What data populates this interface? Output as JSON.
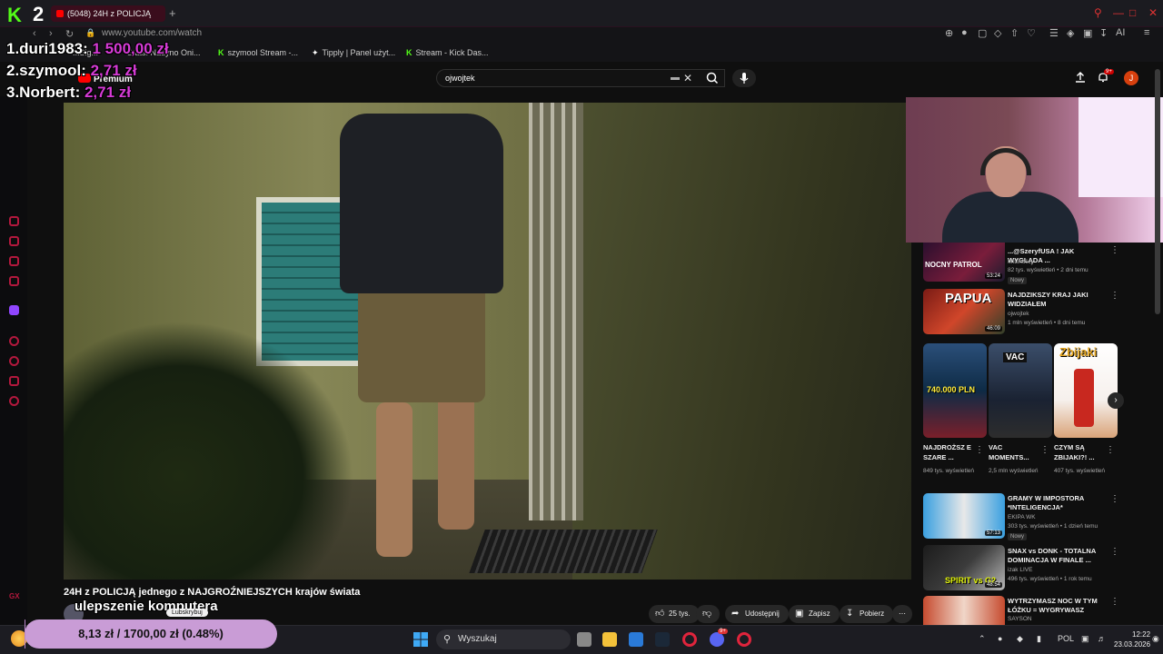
{
  "browser": {
    "tab_title": "(5048) 24H z POLICJĄ",
    "url": "www.youtube.com/watch",
    "bookmarks": [
      "...Sig...",
      "Stats: Nadyno Oni...",
      "szymool Stream -...",
      "Tipply | Panel użyt...",
      "Stream - Kick Das..."
    ],
    "ai_label": "AI",
    "app_number": "2"
  },
  "donors": [
    {
      "rank_name": "1.duri1983:",
      "amount": "1 500,00 zł"
    },
    {
      "rank_name": "2.szymool:",
      "amount": "2,71 zł"
    },
    {
      "rank_name": "3.Norbert:",
      "amount": "2,71 zł"
    }
  ],
  "youtube": {
    "premium_label": "Premium",
    "search_query": "ojwojtek",
    "notifications_badge": "9+",
    "user_initial": "J"
  },
  "video": {
    "title": "24H z POLICJĄ jednego z NAJGROŹNIEJSZYCH krajów świata",
    "overlay_text": "ulepszenie komputera",
    "subscribe_label": "Lubskrybuj",
    "like_count": "25 tys.",
    "share_label": "Udostępnij",
    "save_label": "Zapisz",
    "download_label": "Pobierz"
  },
  "recommendations": [
    {
      "title": "...@SzeryfUSA ! JAK WYGLĄDA ...",
      "channel": "MILiholicy",
      "meta": "82 tys. wyświetleń • 2 dni temu",
      "duration": "53:24",
      "badge": "Nowy",
      "thumb_text": "NOCNY PATROL"
    },
    {
      "title": "NAJDZIKSZY KRAJ JAKI WIDZIAŁEM",
      "channel": "ojwojtek",
      "meta": "1 mln wyświetleń • 8 dni temu",
      "duration": "46:09",
      "badge": "",
      "thumb_text": "PAPUA"
    },
    {
      "title": "GRAMY W IMPOSTORA *INTELIGENCJA*",
      "channel": "EKIPA WK",
      "meta": "303 tys. wyświetleń • 1 dzień temu",
      "duration": "57:13",
      "badge": "Nowy",
      "thumb_text": ""
    },
    {
      "title": "SNAX vs DONK - TOTALNA DOMINACJA W FINALE ...",
      "channel": "izak LIVE",
      "meta": "496 tys. wyświetleń • 1 rok temu",
      "duration": "48:54",
      "badge": "",
      "thumb_text": "SPIRIT vs G2"
    },
    {
      "title": "WYTRZYMASZ NOC W TYM ŁÓŻKU = WYGRYWASZ",
      "channel": "SAYSON",
      "meta": "",
      "duration": "",
      "badge": "",
      "thumb_text": ""
    }
  ],
  "shorts": [
    {
      "title": "NAJDROŻSZ E SZARE ...",
      "meta": "849 tys. wyświetleń",
      "thumb_text": "740.000 PLN"
    },
    {
      "title": "VAC MOMENTS...",
      "meta": "2,5 mln wyświetleń",
      "thumb_text": "VAC"
    },
    {
      "title": "CZYM SĄ ZBIJAKI?! ...",
      "meta": "407 tys. wyświetleń",
      "thumb_text": "Zbijaki"
    }
  ],
  "goal": {
    "text": "8,13 zł / 1700,00 zł (0.48%)",
    "fraction": 0.0048
  },
  "taskbar": {
    "search_placeholder": "Wyszukaj",
    "language": "POL",
    "time": "12:22",
    "date": "23.03.2026",
    "discord_badge": "9+"
  },
  "colors": {
    "kick_green": "#53fc18",
    "yt_red": "#ff0000",
    "donor_amount": "#d63bd6",
    "goal_bar": "#c99cd6"
  }
}
